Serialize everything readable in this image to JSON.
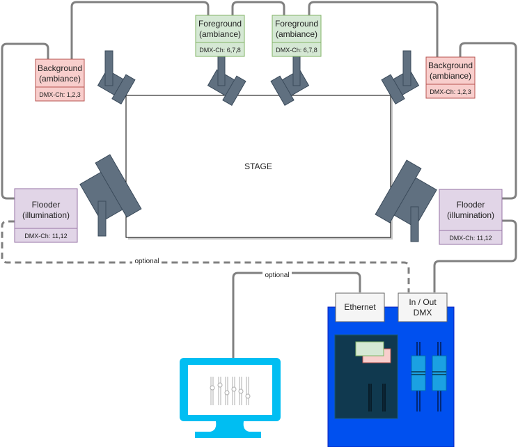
{
  "stage": {
    "label": "STAGE"
  },
  "fixtures": {
    "background_left": {
      "title": "Background",
      "subtitle": "(ambiance)",
      "channels": "DMX-Ch: 1,2,3"
    },
    "foreground_1": {
      "title": "Foreground",
      "subtitle": "(ambiance)",
      "channels": "DMX-Ch: 6,7,8"
    },
    "foreground_2": {
      "title": "Foreground",
      "subtitle": "(ambiance)",
      "channels": "DMX-Ch: 6,7,8"
    },
    "background_right": {
      "title": "Background",
      "subtitle": "(ambiance)",
      "channels": "DMX-Ch: 1,2,3"
    },
    "flooder_left": {
      "title": "Flooder",
      "subtitle": "(illumination)",
      "channels": "DMX-Ch: 11,12"
    },
    "flooder_right": {
      "title": "Flooder",
      "subtitle": "(illumination)",
      "channels": "DMX-Ch: 11,12"
    }
  },
  "links": {
    "optional_dmx": "optional",
    "optional_ethernet": "optional"
  },
  "controller": {
    "ethernet_port": "Ethernet",
    "dmx_port_line1": "In / Out",
    "dmx_port_line2": "DMX"
  },
  "colors": {
    "background_fill": "#f8cecc",
    "background_stroke": "#b85450",
    "foreground_fill": "#d5e8d4",
    "foreground_stroke": "#82b366",
    "flooder_fill": "#e1d5e7",
    "flooder_stroke": "#9673a6",
    "lamp": "#607080",
    "controller": "#0050ef",
    "monitor": "#00bef2"
  }
}
